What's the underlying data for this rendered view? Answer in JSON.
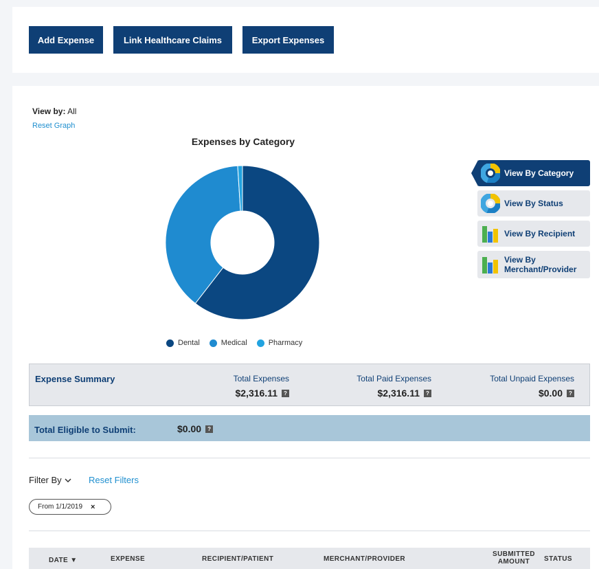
{
  "toolbar": {
    "add_expense": "Add Expense",
    "link_claims": "Link Healthcare Claims",
    "export_expenses": "Export Expenses"
  },
  "view": {
    "label": "View by:",
    "value": " All",
    "reset_graph": "Reset Graph"
  },
  "chart_data": {
    "type": "pie",
    "title": "Expenses by Category",
    "categories": [
      "Dental",
      "Medical",
      "Pharmacy"
    ],
    "values": [
      60.5,
      38.5,
      1.0
    ],
    "colors": [
      "#0b4781",
      "#1f8bd0",
      "#22a3e0"
    ],
    "donut": true,
    "legend_position": "bottom"
  },
  "side_buttons": {
    "category": "View By Category",
    "status": "View By Status",
    "recipient": "View By Recipient",
    "merchant_line1": "View By",
    "merchant_line2": "Merchant/Provider"
  },
  "summary": {
    "label": "Expense Summary",
    "total_label": "Total Expenses",
    "total_value": "$2,316.11",
    "paid_label": "Total Paid Expenses",
    "paid_value": "$2,316.11",
    "unpaid_label": "Total Unpaid Expenses",
    "unpaid_value": "$0.00"
  },
  "eligible": {
    "label": "Total Eligible to Submit:",
    "value": "$0.00"
  },
  "help_glyph": "?",
  "filters": {
    "filter_by": "Filter By",
    "reset": "Reset Filters",
    "chip_label": "From 1/1/2019",
    "chip_close": "×"
  },
  "table": {
    "date": "DATE ▼",
    "expense": "EXPENSE",
    "recipient": "RECIPIENT/PATIENT",
    "merchant": "MERCHANT/PROVIDER",
    "submitted_line1": "SUBMITTED",
    "submitted_line2": "AMOUNT",
    "status": "STATUS"
  }
}
